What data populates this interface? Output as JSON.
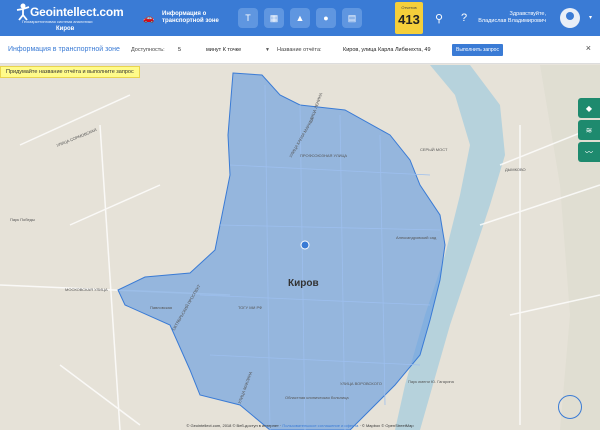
{
  "header": {
    "brand": "Geointellect.com",
    "tagline": "Геомаркетинговая система аналитики",
    "city": "Киров",
    "section_title": "Информация о транспортной зоне",
    "counter_label": "Отчетов",
    "counter_value": "413",
    "greeting_line1": "Здравствуйте,",
    "greeting_line2": "Владислав Владимирович"
  },
  "panel": {
    "title": "Информация в транспортной зоне",
    "availability_label": "Доступность:",
    "availability_value": "5",
    "unit_value": "минут К точке",
    "report_name_label": "Название отчёта:",
    "report_name_value": "Киров, улица Карла Либкнехта, 49",
    "run_button": "Выполнить запрос"
  },
  "hint": "Придумайте название отчёта и выполните запрос",
  "map": {
    "city_label": "Киров",
    "streets": [
      "УЛИЦА ЛЕНИНА",
      "ПРОФСОЮЗНАЯ УЛИЦА",
      "УЛИЦА КАРЛА МАРКСА",
      "МОСКОВСКАЯ УЛИЦА",
      "ОКТЯБРЬСКИЙ ПРОСПЕКТ",
      "УЛИЦА МАКЛИНА",
      "УЛИЦА ВОРОВСКОГО",
      "СЕРЫЙ МОСТ",
      "УЛИЦА СОРМОВСКАЯ",
      "Парк Победы",
      "Павловская",
      "ДЫМКОВО",
      "Парк имени Ю. Гагарина",
      "Александровский сад",
      "ТОГУ МИ РФ",
      "Областная клиническая больница"
    ]
  },
  "footer": {
    "copyright": "© Geointellect.com, 2018 © Веб-доступ в интернет · ",
    "agreement": "Пользовательское соглашение и оферта",
    "mapbox": "© Mapbox © OpenStreetMap"
  },
  "colors": {
    "topbar": "#3a7bd5",
    "zone_fill": "#6a9ee0",
    "counter": "#f5cf3a",
    "layers": "#1e8a6e"
  }
}
